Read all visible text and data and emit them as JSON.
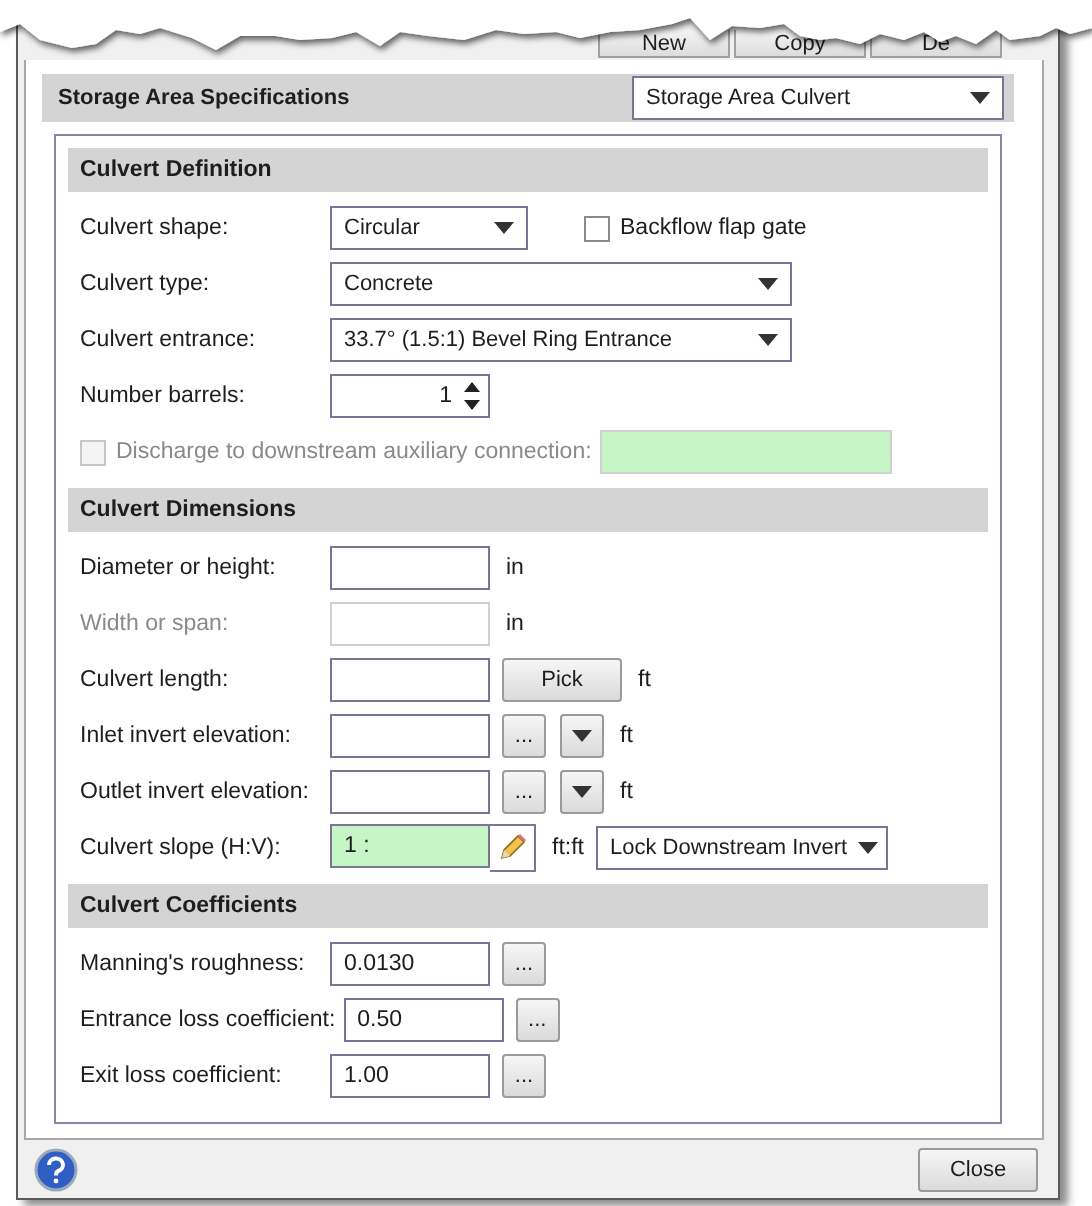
{
  "top_buttons": [
    "New",
    "Copy",
    "De"
  ],
  "header": {
    "title": "Storage Area Specifications",
    "selector": "Storage Area Culvert"
  },
  "sections": [
    {
      "title": "Culvert Definition",
      "rows": [
        {
          "kind": "select",
          "label": "Culvert shape:",
          "value": "Circular",
          "checkbox": {
            "label": "Backflow flap gate",
            "checked": false
          }
        },
        {
          "kind": "select",
          "label": "Culvert type:",
          "value": "Concrete"
        },
        {
          "kind": "select",
          "label": "Culvert entrance:",
          "value": "33.7° (1.5:1) Bevel Ring Entrance"
        },
        {
          "kind": "spinner",
          "label": "Number barrels:",
          "value": "1"
        },
        {
          "kind": "check-field",
          "label": "Discharge to downstream auxiliary connection:",
          "checked": false,
          "disabled": true
        }
      ]
    },
    {
      "title": "Culvert Dimensions",
      "rows": [
        {
          "kind": "field",
          "label": "Diameter or height:",
          "unit": "in",
          "disabled": false
        },
        {
          "kind": "field",
          "label": "Width or span:",
          "unit": "in",
          "disabled": true
        },
        {
          "kind": "pick",
          "label": "Culvert length:",
          "button": "Pick",
          "unit": "ft"
        },
        {
          "kind": "elevation",
          "label": "Inlet invert elevation:",
          "button": "...",
          "unit": "ft"
        },
        {
          "kind": "elevation",
          "label": "Outlet invert elevation:",
          "button": "...",
          "unit": "ft"
        },
        {
          "kind": "slope",
          "label": "Culvert slope (H:V):",
          "value": "1 :",
          "unit": "ft:ft",
          "mode": "Lock Downstream Invert"
        }
      ]
    },
    {
      "title": "Culvert Coefficients",
      "rows": [
        {
          "kind": "coefficient",
          "label": "Manning's roughness:",
          "value": "0.0130",
          "button": "..."
        },
        {
          "kind": "coefficient",
          "label": "Entrance loss coefficient:",
          "value": "0.50",
          "button": "..."
        },
        {
          "kind": "coefficient",
          "label": "Exit loss coefficient:",
          "value": "1.00",
          "button": "..."
        }
      ]
    }
  ],
  "footer": {
    "close": "Close"
  }
}
